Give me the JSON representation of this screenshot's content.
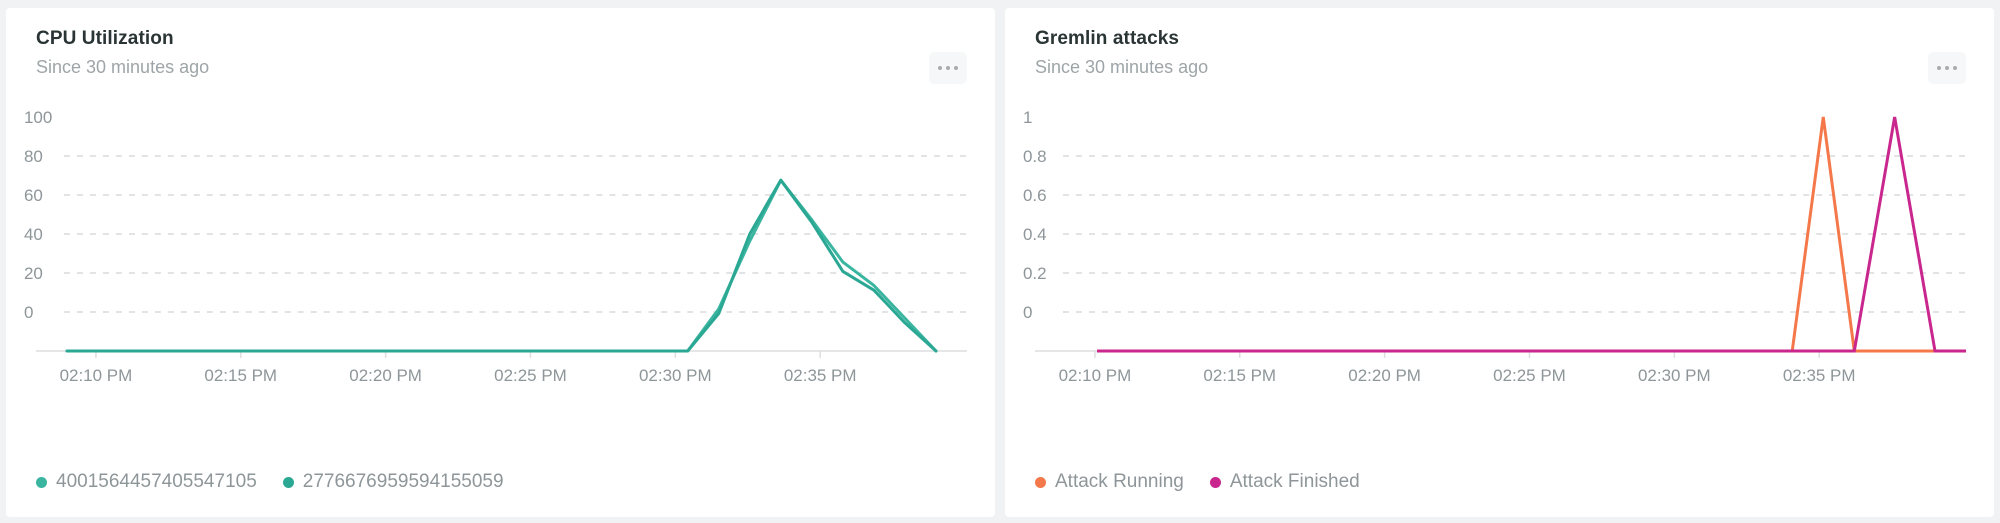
{
  "background_color": "#f1f2f3",
  "panels": [
    {
      "title": "CPU Utilization",
      "subtitle": "Since 30 minutes ago",
      "menu_label": "•••",
      "legend": [
        {
          "label": "4001564457405547105",
          "color": "#3ab5a0"
        },
        {
          "label": "2776676959594155059",
          "color": "#2ba894"
        }
      ]
    },
    {
      "title": "Gremlin attacks",
      "subtitle": "Since 30 minutes ago",
      "menu_label": "•••",
      "legend": [
        {
          "label": "Attack Running",
          "color": "#f4784a"
        },
        {
          "label": "Attack Finished",
          "color": "#c9268e"
        }
      ]
    }
  ],
  "chart_data": [
    {
      "type": "line",
      "title": "CPU Utilization",
      "subtitle": "Since 30 minutes ago",
      "xlabel": "",
      "ylabel": "",
      "ylim": [
        0,
        100
      ],
      "yticks": [
        0,
        20,
        40,
        60,
        80,
        100
      ],
      "ytick_labels": [
        "0",
        "20",
        "40",
        "60",
        "80",
        "100"
      ],
      "xtick_labels": [
        "02:10 PM",
        "02:15 PM",
        "02:20 PM",
        "02:25 PM",
        "02:30 PM",
        "02:35 PM"
      ],
      "xlim_minutes": [
        128,
        158
      ],
      "grid": "horizontal-dashed",
      "legend_position": "bottom-left",
      "series": [
        {
          "name": "4001564457405547105",
          "color": "#3ab5a0",
          "x": [
            129,
            131,
            133,
            135,
            137,
            139,
            141,
            143,
            145,
            146,
            147,
            148,
            149,
            150,
            151,
            152,
            153,
            154,
            155,
            156,
            157
          ],
          "values": [
            0,
            0,
            0,
            0,
            0,
            0,
            0,
            0,
            0,
            0,
            0,
            0,
            0,
            18,
            47,
            73,
            56,
            38,
            28,
            14,
            0
          ]
        },
        {
          "name": "2776676959594155059",
          "color": "#2ba894",
          "x": [
            129,
            131,
            133,
            135,
            137,
            139,
            141,
            143,
            145,
            146,
            147,
            148,
            149,
            150,
            151,
            152,
            153,
            154,
            155,
            156,
            157
          ],
          "values": [
            0,
            0,
            0,
            0,
            0,
            0,
            0,
            0,
            0,
            0,
            0,
            0,
            0,
            16,
            50,
            73,
            55,
            34,
            26,
            12,
            0
          ]
        }
      ]
    },
    {
      "type": "line",
      "title": "Gremlin attacks",
      "subtitle": "Since 30 minutes ago",
      "xlabel": "",
      "ylabel": "",
      "ylim": [
        0,
        1
      ],
      "yticks": [
        0,
        0.2,
        0.4,
        0.6,
        0.8,
        1
      ],
      "ytick_labels": [
        "0",
        "0.2",
        "0.4",
        "0.6",
        "0.8",
        "1"
      ],
      "xtick_labels": [
        "02:10 PM",
        "02:15 PM",
        "02:20 PM",
        "02:25 PM",
        "02:30 PM",
        "02:35 PM"
      ],
      "xlim_minutes": [
        128,
        158
      ],
      "grid": "horizontal-dashed",
      "legend_position": "bottom-left",
      "series": [
        {
          "name": "Attack Running",
          "color": "#f4784a",
          "x": [
            130,
            152.4,
            153.4,
            154.4,
            158
          ],
          "values": [
            0,
            0,
            1,
            0,
            0
          ]
        },
        {
          "name": "Attack Finished",
          "color": "#c9268e",
          "x": [
            130,
            154.4,
            155.7,
            157.0,
            158
          ],
          "values": [
            0,
            0,
            1,
            0,
            0
          ]
        }
      ]
    }
  ]
}
